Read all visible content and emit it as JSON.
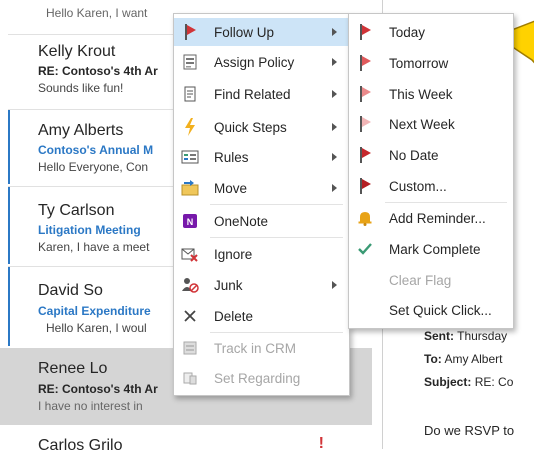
{
  "messages": [
    {
      "sender": "",
      "subject": "",
      "preview": "Hello Karen, I want",
      "partial": true
    },
    {
      "sender": "Kelly Krout",
      "subject": "RE: Contoso's 4th Ar",
      "preview": "Sounds like fun!"
    },
    {
      "sender": "Amy Alberts",
      "subject": "Contoso's Annual M",
      "preview": "Hello Everyone,  Con"
    },
    {
      "sender": "Ty Carlson",
      "subject": "Litigation Meeting",
      "preview": "Karen,  I have a meet"
    },
    {
      "sender": "David So",
      "subject": "Capital Expenditure",
      "preview": "Hello Karen,  I woul"
    },
    {
      "sender": "Renee Lo",
      "subject": "RE: Contoso's 4th Ar",
      "preview": "I have no interest in"
    },
    {
      "sender": "Carlos Grilo",
      "subject": "",
      "preview": ""
    }
  ],
  "reading_pane": {
    "sent_label": "Sent:",
    "sent_value": "Thursday",
    "to_label": "To:",
    "to_value": "Amy Albert",
    "subject_label": "Subject:",
    "subject_value": "RE: Co",
    "body_start": "Do we RSVP to"
  },
  "context_menu": [
    {
      "label": "Follow Up",
      "icon": "flag-icon",
      "submenu": true,
      "highlighted": true
    },
    {
      "label": "Assign Policy",
      "icon": "policy-icon",
      "submenu": true
    },
    {
      "label": "Find Related",
      "icon": "find-related-icon",
      "submenu": true
    },
    {
      "label": "Quick Steps",
      "icon": "lightning-icon",
      "submenu": true
    },
    {
      "label": "Rules",
      "icon": "rules-icon",
      "submenu": true
    },
    {
      "label": "Move",
      "icon": "move-icon",
      "submenu": true
    },
    {
      "label": "OneNote",
      "icon": "onenote-icon",
      "submenu": false
    },
    {
      "label": "Ignore",
      "icon": "ignore-icon",
      "submenu": false
    },
    {
      "label": "Junk",
      "icon": "junk-icon",
      "submenu": true
    },
    {
      "label": "Delete",
      "icon": "delete-icon",
      "submenu": false
    },
    {
      "label": "Track in CRM",
      "icon": "crm-icon",
      "submenu": false,
      "disabled": true
    },
    {
      "label": "Set Regarding",
      "icon": "regarding-icon",
      "submenu": false,
      "disabled": true
    }
  ],
  "follow_up_menu": [
    {
      "label": "Today",
      "icon": "flag-today-icon"
    },
    {
      "label": "Tomorrow",
      "icon": "flag-tomorrow-icon"
    },
    {
      "label": "This Week",
      "icon": "flag-this-week-icon"
    },
    {
      "label": "Next Week",
      "icon": "flag-next-week-icon"
    },
    {
      "label": "No Date",
      "icon": "flag-no-date-icon"
    },
    {
      "label": "Custom...",
      "icon": "flag-custom-icon"
    },
    {
      "label": "Add Reminder...",
      "icon": "bell-icon"
    },
    {
      "label": "Mark Complete",
      "icon": "checkmark-icon"
    },
    {
      "label": "Clear Flag",
      "icon": "",
      "disabled": true
    },
    {
      "label": "Set Quick Click...",
      "icon": ""
    }
  ],
  "colors": {
    "accent_blue": "#2b78c5",
    "flag_red": "#d13438",
    "highlight": "#cde4f7",
    "selected_row": "#d5d5d5",
    "check_green": "#3a9a74",
    "bell_yellow": "#e8a317",
    "callout_yellow": "#ffd200"
  }
}
